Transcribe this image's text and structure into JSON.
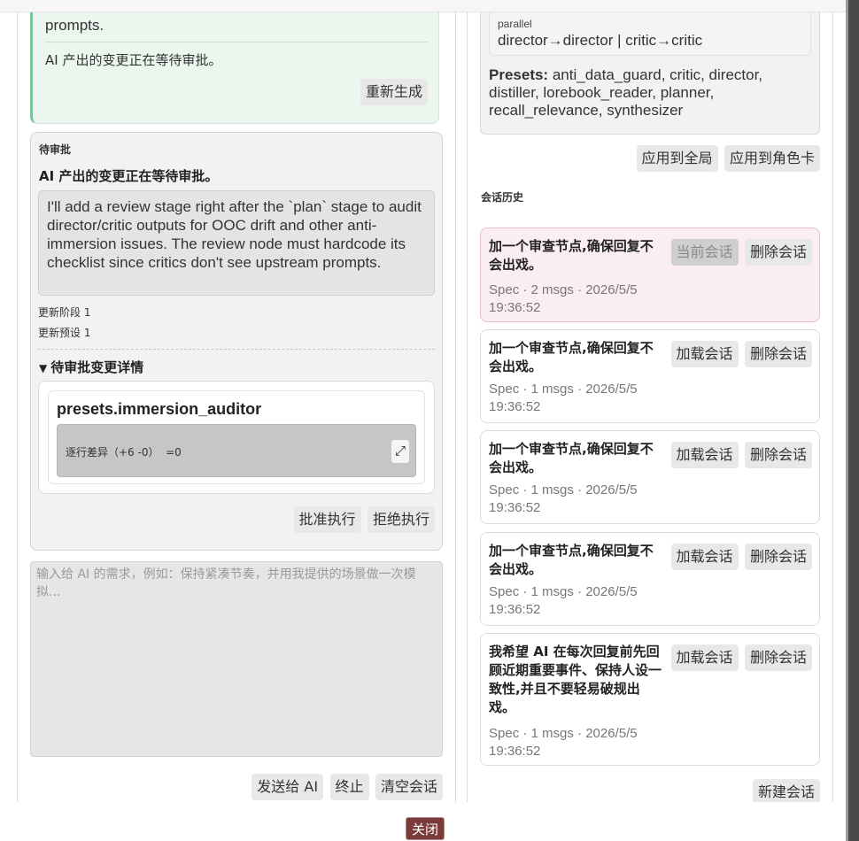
{
  "left": {
    "ai_message": {
      "text_tail": "prompts.",
      "pending_note": "AI 产出的变更正在等待审批。",
      "regenerate_label": "重新生成"
    },
    "pending": {
      "label": "待审批",
      "heading": "AI 产出的变更正在等待审批。",
      "quote": "I'll add a review stage right after the `plan` stage to audit director/critic outputs for OOC drift and other anti-immersion issues. The review node must hardcode its checklist since critics don't see upstream prompts.",
      "updated_stages": "更新阶段 1",
      "updated_presets": "更新预设 1",
      "details_label": "待审批变更详情",
      "change_name": "presets.immersion_auditor",
      "diff_stat": "逐行差异（+6 -0）  =0",
      "approve_label": "批准执行",
      "reject_label": "拒绝执行"
    },
    "prompt": {
      "placeholder": "输入给 AI 的需求，例如：保持紧凑节奏，并用我提供的场景做一次模拟..."
    },
    "actions": {
      "send_label": "发送给 AI",
      "stop_label": "终止",
      "clear_label": "清空会话"
    }
  },
  "right": {
    "config": {
      "mode": "parallel",
      "edges": "director→director | critic→critic",
      "presets_label": "Presets:",
      "presets_value": " anti_data_guard, critic, director, distiller, lorebook_reader, planner, recall_relevance, synthesizer"
    },
    "apply_global_label": "应用到全局",
    "apply_card_label": "应用到角色卡",
    "history_title": "会话历史",
    "sessions": [
      {
        "title": "加一个审查节点,确保回复不会出戏。",
        "meta": "Spec · 2 msgs · 2026/5/5 19:36:52",
        "primary": "当前会话",
        "delete": "删除会话"
      },
      {
        "title": "加一个审查节点,确保回复不会出戏。",
        "meta": "Spec · 1 msgs · 2026/5/5 19:36:52",
        "primary": "加载会话",
        "delete": "删除会话"
      },
      {
        "title": "加一个审查节点,确保回复不会出戏。",
        "meta": "Spec · 1 msgs · 2026/5/5 19:36:52",
        "primary": "加载会话",
        "delete": "删除会话"
      },
      {
        "title": "加一个审查节点,确保回复不会出戏。",
        "meta": "Spec · 1 msgs · 2026/5/5 19:36:52",
        "primary": "加载会话",
        "delete": "删除会话"
      },
      {
        "title": "我希望 AI 在每次回复前先回顾近期重要事件、保持人设一致性,并且不要轻易破规出戏。",
        "meta": "Spec · 1 msgs · 2026/5/5 19:36:52",
        "primary": "加载会话",
        "delete": "删除会话"
      }
    ],
    "new_session_label": "新建会话"
  },
  "close_label": "关闭"
}
